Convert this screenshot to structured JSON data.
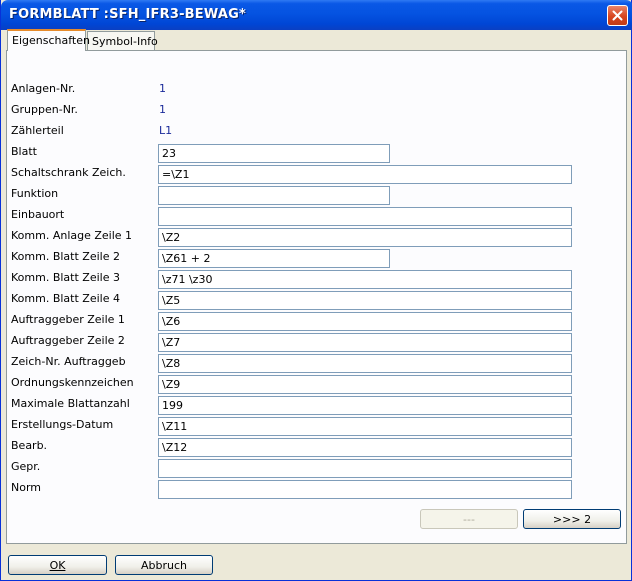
{
  "window": {
    "title": "FORMBLATT :SFH_IFR3-BEWAG*"
  },
  "tabs": [
    "Eigenschaften",
    "Symbol-Info"
  ],
  "static_fields": [
    {
      "label": "Anlagen-Nr.",
      "value": "1"
    },
    {
      "label": "Gruppen-Nr.",
      "value": "1"
    },
    {
      "label": "Zählerteil",
      "value": "L1"
    }
  ],
  "fields": [
    {
      "label": "Blatt",
      "value": "23"
    },
    {
      "label": "Schaltschrank Zeich.",
      "value": "=\\Z1"
    },
    {
      "label": "Funktion",
      "value": ""
    },
    {
      "label": "Einbauort",
      "value": ""
    },
    {
      "label": "Komm. Anlage Zeile 1",
      "value": "\\Z2"
    },
    {
      "label": "Komm. Blatt  Zeile 2",
      "value": "\\Z61 + 2"
    },
    {
      "label": "Komm. Blatt  Zeile 3",
      "value": "\\z71 \\z30"
    },
    {
      "label": "Komm. Blatt  Zeile 4",
      "value": "\\Z5"
    },
    {
      "label": "Auftraggeber Zeile 1",
      "value": "\\Z6"
    },
    {
      "label": "Auftraggeber Zeile 2",
      "value": "\\Z7"
    },
    {
      "label": "Zeich-Nr. Auftraggeb",
      "value": "\\Z8"
    },
    {
      "label": "Ordnungskennzeichen",
      "value": "\\Z9"
    },
    {
      "label": "Maximale Blattanzahl",
      "value": "199"
    },
    {
      "label": "Erstellungs-Datum",
      "value": "\\Z11"
    },
    {
      "label": "Bearb.",
      "value": "\\Z12"
    },
    {
      "label": "Gepr.",
      "value": ""
    },
    {
      "label": "Norm",
      "value": ""
    }
  ],
  "nav": {
    "prev_label": "---",
    "next_label": ">>> 2"
  },
  "footer": {
    "ok_label": "OK",
    "cancel_label": "Abbruch"
  },
  "icons": {
    "close": "close-icon"
  },
  "colors": {
    "title_bar": "#0553e1",
    "close_button": "#d8451f",
    "value_text": "#1a2a9a"
  }
}
